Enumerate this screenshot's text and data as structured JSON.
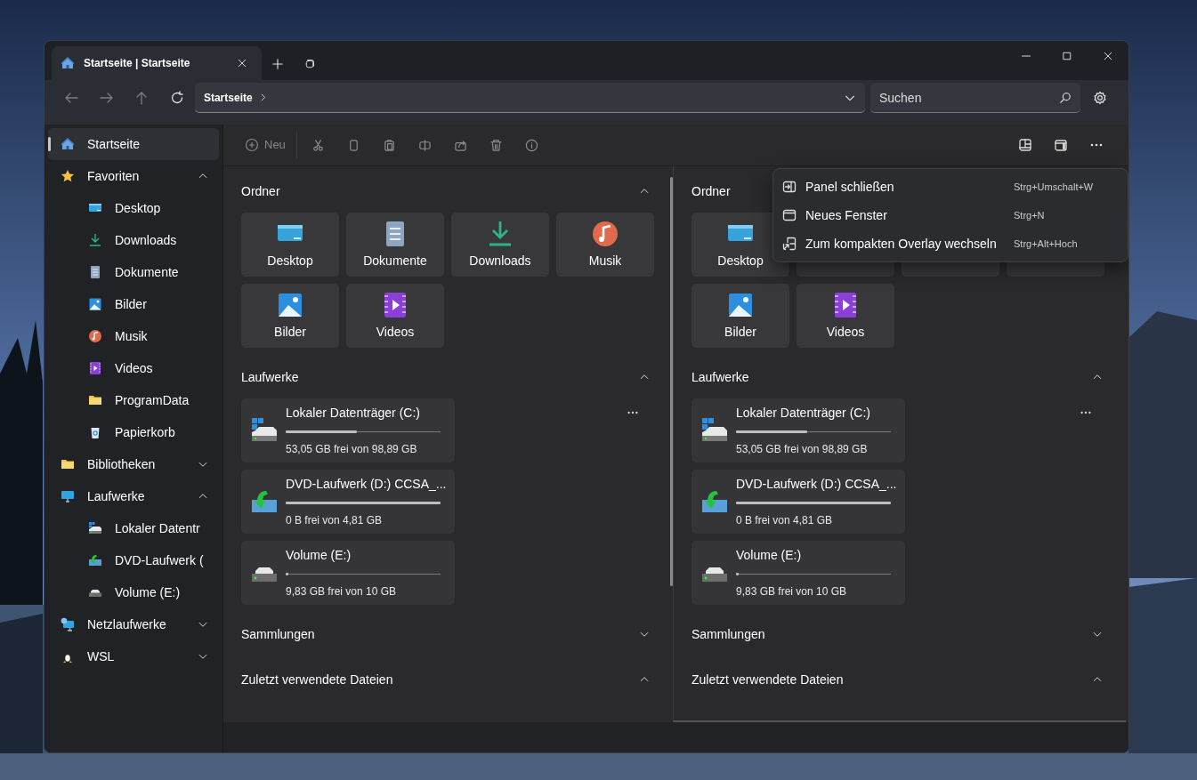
{
  "tabs": [
    {
      "label": "Startseite | Startseite",
      "selected": true
    }
  ],
  "address": {
    "crumbs": [
      "Startseite"
    ]
  },
  "search": {
    "placeholder": "Suchen"
  },
  "sidebar": {
    "items": [
      {
        "label": "Startseite",
        "kind": "home",
        "selected": true
      },
      {
        "label": "Favoriten",
        "kind": "star",
        "selected": false,
        "expanded": true,
        "children": [
          {
            "label": "Desktop",
            "kind": "desktop",
            "selected": false
          },
          {
            "label": "Downloads",
            "kind": "downloads",
            "selected": false
          },
          {
            "label": "Dokumente",
            "kind": "documents",
            "selected": false
          },
          {
            "label": "Bilder",
            "kind": "pictures",
            "selected": false
          },
          {
            "label": "Musik",
            "kind": "music",
            "selected": false
          },
          {
            "label": "Videos",
            "kind": "videos",
            "selected": false
          },
          {
            "label": "ProgramData",
            "kind": "folder",
            "selected": false
          },
          {
            "label": "Papierkorb",
            "kind": "recycle",
            "selected": false
          }
        ]
      },
      {
        "label": "Bibliotheken",
        "kind": "folder",
        "selected": false,
        "expanded": false
      },
      {
        "label": "Laufwerke",
        "kind": "pc",
        "selected": false,
        "expanded": true,
        "children": [
          {
            "label": "Lokaler Datentr",
            "kind": "drive-win",
            "selected": false
          },
          {
            "label": "DVD-Laufwerk (",
            "kind": "dvd",
            "selected": false
          },
          {
            "label": "Volume (E:)",
            "kind": "drive",
            "selected": false
          }
        ]
      },
      {
        "label": "Netzlaufwerke",
        "kind": "network",
        "selected": false,
        "expanded": false
      },
      {
        "label": "WSL",
        "kind": "linux",
        "selected": false,
        "expanded": false
      }
    ]
  },
  "toolbar": {
    "new_label": "Neu"
  },
  "panes": [
    {
      "sections": [
        {
          "title": "Ordner",
          "expanded": true,
          "kind": "folders",
          "folders": [
            {
              "label": "Desktop",
              "kind": "desktop"
            },
            {
              "label": "Dokumente",
              "kind": "documents"
            },
            {
              "label": "Downloads",
              "kind": "downloads"
            },
            {
              "label": "Musik",
              "kind": "music"
            },
            {
              "label": "Bilder",
              "kind": "pictures"
            },
            {
              "label": "Videos",
              "kind": "videos"
            }
          ]
        },
        {
          "title": "Laufwerke",
          "expanded": true,
          "kind": "drives",
          "drives": [
            {
              "name": "Lokaler Datenträger (C:)",
              "kind": "drive-win",
              "level": 0.46,
              "free": "53,05 GB frei von 98,89 GB"
            },
            {
              "name": "DVD-Laufwerk (D:) CCSA_...",
              "kind": "dvd",
              "level": 1,
              "free": "0 B frei von 4,81 GB"
            },
            {
              "name": "Volume (E:)",
              "kind": "drive",
              "level": 0.02,
              "free": "9,83 GB frei von 10 GB"
            }
          ]
        },
        {
          "title": "Sammlungen",
          "expanded": false,
          "kind": "plain"
        },
        {
          "title": "Zuletzt verwendete Dateien",
          "expanded": true,
          "kind": "plain"
        }
      ]
    },
    {
      "sections": [
        {
          "title": "Ordner",
          "kind": "folders",
          "folders": [
            {
              "label": "Desktop",
              "kind": "desktop"
            },
            {
              "kind": "covered"
            },
            {
              "kind": "covered"
            },
            {
              "kind": "covered"
            },
            {
              "label": "Bilder",
              "kind": "pictures"
            },
            {
              "label": "Videos",
              "kind": "videos"
            }
          ]
        },
        {
          "title": "Laufwerke",
          "expanded": true,
          "kind": "drives",
          "drives": [
            {
              "name": "Lokaler Datenträger (C:)",
              "kind": "drive-win",
              "level": 0.46,
              "free": "53,05 GB frei von 98,89 GB"
            },
            {
              "name": "DVD-Laufwerk (D:) CCSA_...",
              "kind": "dvd",
              "level": 1,
              "free": "0 B frei von 4,81 GB"
            },
            {
              "name": "Volume (E:)",
              "kind": "drive",
              "level": 0.02,
              "free": "9,83 GB frei von 10 GB"
            }
          ]
        },
        {
          "title": "Sammlungen",
          "expanded": false,
          "kind": "plain"
        },
        {
          "title": "Zuletzt verwendete Dateien",
          "expanded": true,
          "kind": "plain"
        }
      ]
    }
  ],
  "menu": {
    "items": [
      {
        "label": "Panel schließen",
        "shortcut": "Strg+Umschalt+W",
        "kind": "close-pane"
      },
      {
        "label": "Neues Fenster",
        "shortcut": "Strg+N",
        "kind": "window"
      },
      {
        "label": "Zum kompakten Overlay wechseln",
        "shortcut": "Strg+Alt+Hoch",
        "kind": "overlay"
      }
    ]
  }
}
